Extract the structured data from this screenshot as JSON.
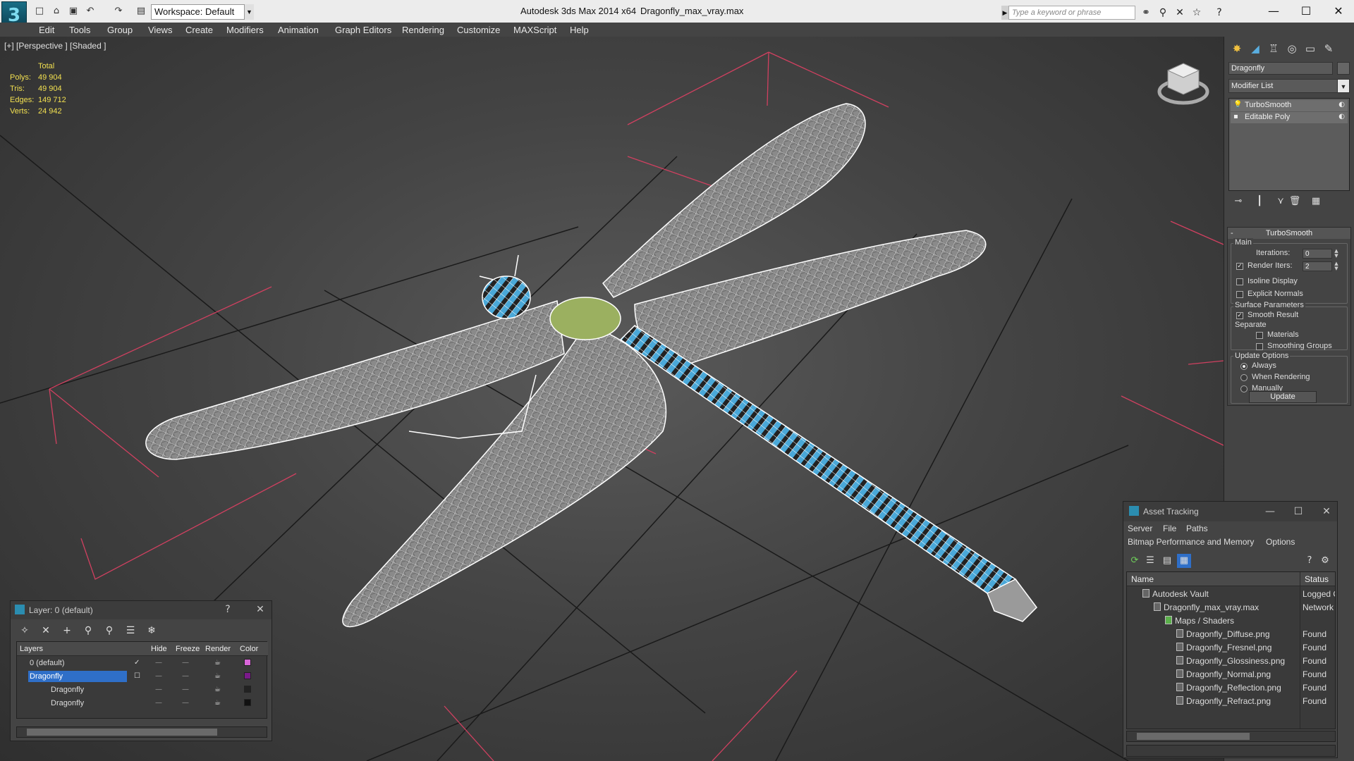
{
  "app": {
    "title": "Autodesk 3ds Max  2014 x64",
    "file": "Dragonfly_max_vray.max",
    "workspace": "Workspace: Default",
    "search_placeholder": "Type a keyword or phrase"
  },
  "menus": [
    "Edit",
    "Tools",
    "Group",
    "Views",
    "Create",
    "Modifiers",
    "Animation",
    "Graph Editors",
    "Rendering",
    "Customize",
    "MAXScript",
    "Help"
  ],
  "viewport": {
    "label": "[+] [Perspective ] [Shaded ]",
    "stats_header": "Total",
    "stats": [
      {
        "key": "Polys:",
        "value": "49 904"
      },
      {
        "key": "Tris:",
        "value": "49 904"
      },
      {
        "key": "Edges:",
        "value": "149 712"
      },
      {
        "key": "Verts:",
        "value": "24 942"
      }
    ]
  },
  "command_panel": {
    "object_name": "Dragonfly",
    "modifier_list": "Modifier List",
    "stack": [
      "TurboSmooth",
      "Editable Poly"
    ],
    "rollout_title": "TurboSmooth",
    "main_group": "Main",
    "iterations_label": "Iterations:",
    "iterations_value": "0",
    "render_iters_label": "Render Iters:",
    "render_iters_value": "2",
    "render_iters_checked": true,
    "isoline_label": "Isoline Display",
    "explicit_normals_label": "Explicit Normals",
    "surface_group": "Surface Parameters",
    "smooth_result_label": "Smooth Result",
    "separate_label": "Separate",
    "materials_label": "Materials",
    "smoothing_groups_label": "Smoothing Groups",
    "update_group": "Update Options",
    "always_label": "Always",
    "when_rendering_label": "When Rendering",
    "manually_label": "Manually",
    "update_button": "Update"
  },
  "asset_tracking": {
    "title": "Asset Tracking",
    "menu_row1": [
      "Server",
      "File",
      "Paths"
    ],
    "menu_row2": [
      "Bitmap Performance and Memory",
      "Options"
    ],
    "columns": [
      "Name",
      "Status"
    ],
    "rows": [
      {
        "name": "Autodesk Vault",
        "status": "Logged O",
        "indent": 0
      },
      {
        "name": "Dragonfly_max_vray.max",
        "status": "Network",
        "indent": 1
      },
      {
        "name": "Maps / Shaders",
        "status": "",
        "indent": 2
      },
      {
        "name": "Dragonfly_Diffuse.png",
        "status": "Found",
        "indent": 3
      },
      {
        "name": "Dragonfly_Fresnel.png",
        "status": "Found",
        "indent": 3
      },
      {
        "name": "Dragonfly_Glossiness.png",
        "status": "Found",
        "indent": 3
      },
      {
        "name": "Dragonfly_Normal.png",
        "status": "Found",
        "indent": 3
      },
      {
        "name": "Dragonfly_Reflection.png",
        "status": "Found",
        "indent": 3
      },
      {
        "name": "Dragonfly_Refract.png",
        "status": "Found",
        "indent": 3
      }
    ]
  },
  "layer_dialog": {
    "title": "Layer: 0 (default)",
    "help": "?",
    "columns": [
      "Layers",
      "Hide",
      "Freeze",
      "Render",
      "Color"
    ],
    "rows": [
      {
        "name": "0 (default)",
        "color": "#d966d9",
        "selected": false
      },
      {
        "name": "Dragonfly",
        "color": "#7a1a8a",
        "selected": true
      },
      {
        "name": "Dragonfly",
        "color": "#222222",
        "selected": false
      },
      {
        "name": "Dragonfly",
        "color": "#111111",
        "selected": false
      }
    ]
  },
  "colors": {
    "accent_blue": "#2f6fc8",
    "stats_yellow": "#f2e050",
    "wire_white": "#ffffff",
    "body_blue": "#4aa8d8",
    "bbox_red": "#d04060"
  }
}
